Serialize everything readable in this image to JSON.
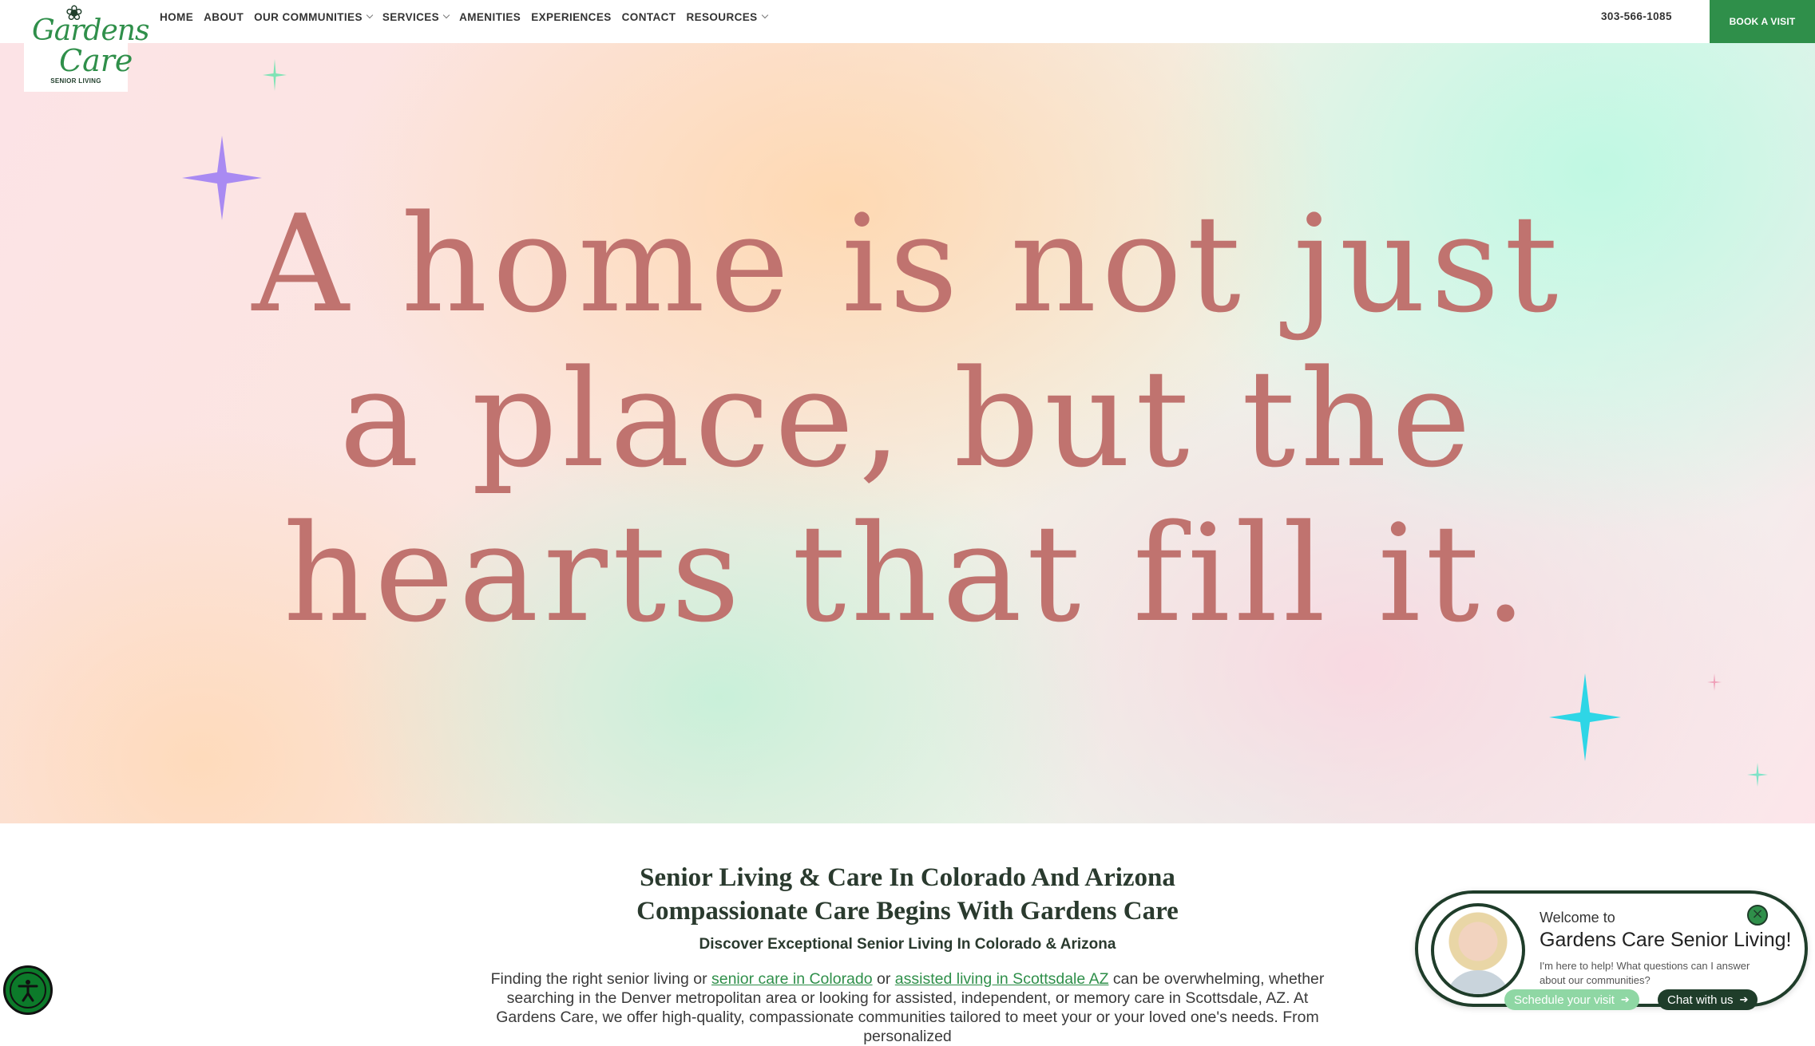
{
  "brand": {
    "logo_line1": "Gardens",
    "logo_line2": "Care",
    "logo_tagline": "SENIOR LIVING",
    "color_primary": "#2f8f4a",
    "color_dark": "#1f3d2a",
    "color_quote": "#c0736f"
  },
  "nav": {
    "items": [
      {
        "label": "HOME",
        "has_dropdown": false
      },
      {
        "label": "ABOUT",
        "has_dropdown": false
      },
      {
        "label": "OUR COMMUNITIES",
        "has_dropdown": true
      },
      {
        "label": "SERVICES",
        "has_dropdown": true
      },
      {
        "label": "AMENITIES",
        "has_dropdown": false
      },
      {
        "label": "EXPERIENCES",
        "has_dropdown": false
      },
      {
        "label": "CONTACT",
        "has_dropdown": false
      },
      {
        "label": "RESOURCES",
        "has_dropdown": true
      }
    ],
    "phone": "303-566-1085",
    "cta": "BOOK A VISIT"
  },
  "hero": {
    "quote_lines": [
      "A home is not just",
      "a place, but the",
      "hearts that fill it."
    ]
  },
  "intro": {
    "heading_1": "Senior Living & Care In Colorado And Arizona",
    "heading_2": "Compassionate Care Begins With Gardens Care",
    "subheading": "Discover Exceptional Senior Living In Colorado & Arizona",
    "para_1": "Finding the right senior living or ",
    "link_1": "senior care in Colorado",
    "para_2": " or ",
    "link_2": "assisted living in Scottsdale AZ",
    "para_3": " can be overwhelming, whether searching in the Denver metropolitan area or looking for assisted, independent, or memory care in Scottsdale, AZ. At Gardens Care, we offer high-quality, compassionate communities tailored to meet your or your loved one's needs. From personalized"
  },
  "chat": {
    "welcome": "Welcome to",
    "title": "Gardens Care Senior Living!",
    "message": "I'm here to help! What questions can I answer about our communities?",
    "btn_visit": "Schedule your visit",
    "btn_chat": "Chat with us"
  }
}
